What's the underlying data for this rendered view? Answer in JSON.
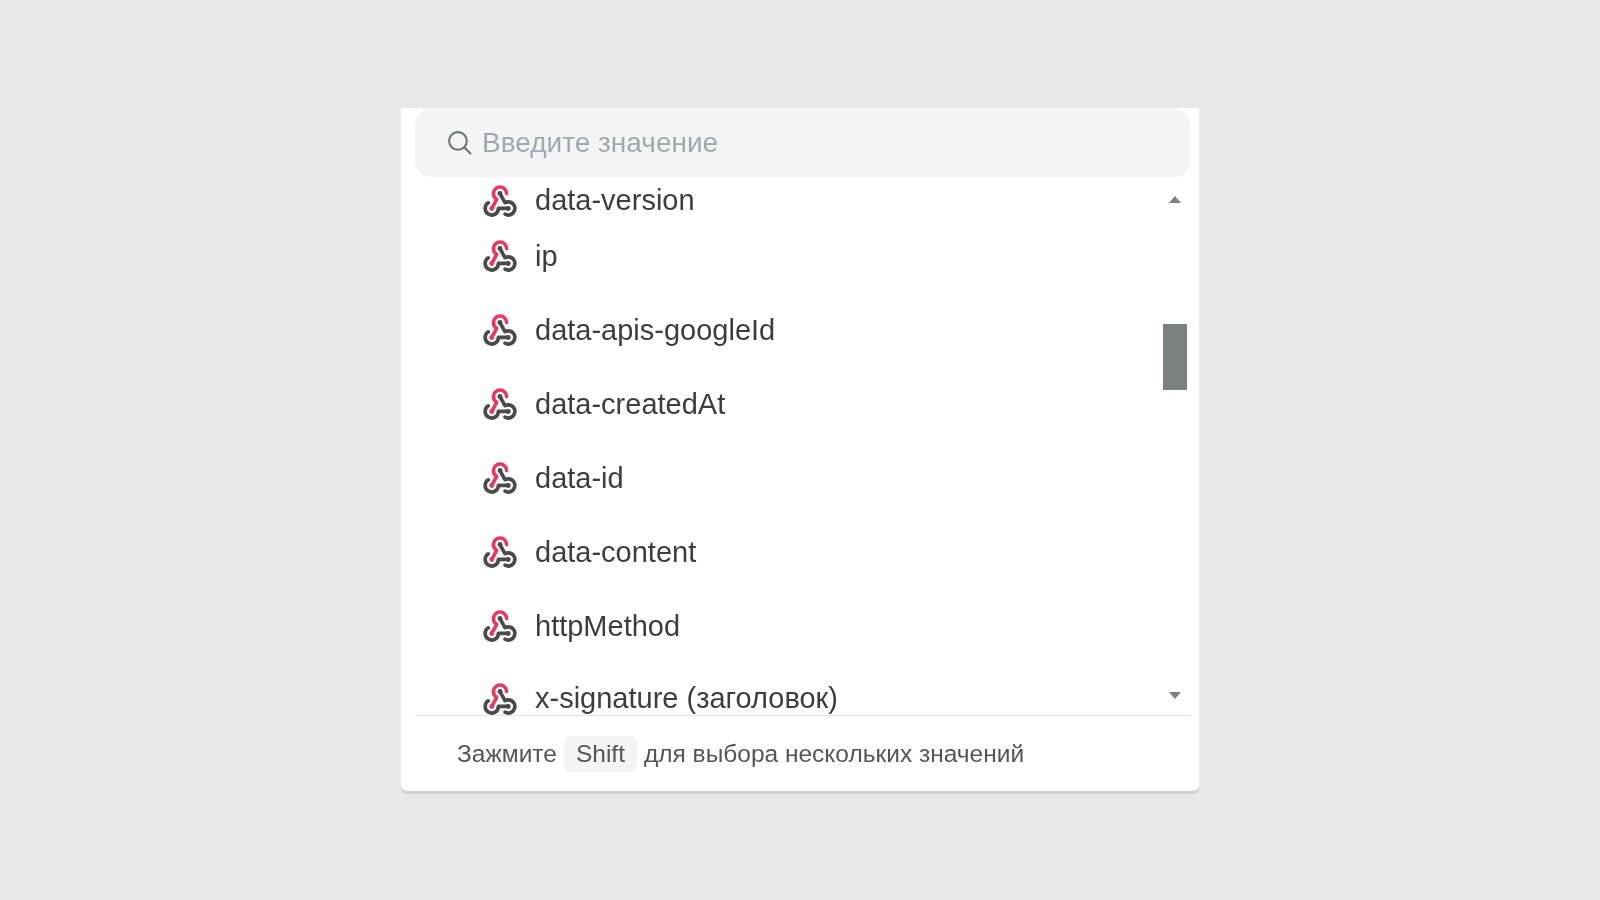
{
  "search": {
    "placeholder": "Введите значение"
  },
  "options": [
    {
      "label": "data-version"
    },
    {
      "label": "ip"
    },
    {
      "label": "data-apis-googleId"
    },
    {
      "label": "data-createdAt"
    },
    {
      "label": "data-id"
    },
    {
      "label": "data-content"
    },
    {
      "label": "httpMethod"
    },
    {
      "label": "x-signature (заголовок)"
    }
  ],
  "hint": {
    "text_before": "Зажмите",
    "key": "Shift",
    "text_after": "для выбора нескольких значений"
  }
}
